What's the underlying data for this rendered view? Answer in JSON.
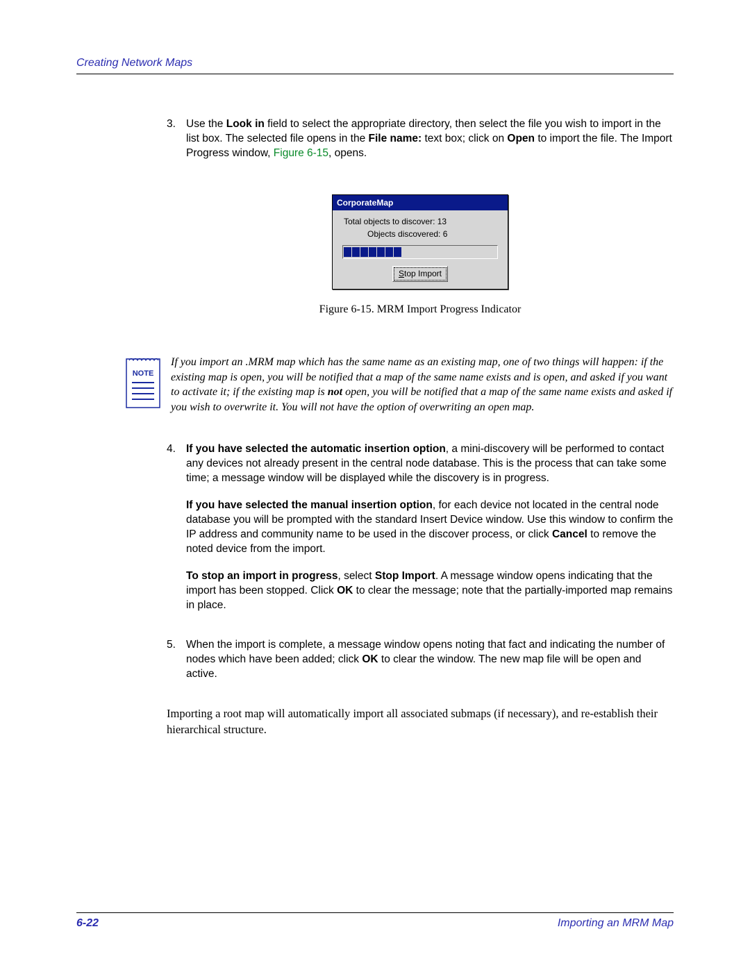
{
  "header": {
    "title": "Creating Network Maps"
  },
  "step3": {
    "num": "3.",
    "p1a": "Use the ",
    "look_in": "Look in",
    "p1b": " field to select the appropriate directory, then select the file you wish to import in the list box. The selected file opens in the ",
    "file_name": "File name:",
    "p1c": " text box; click on ",
    "open": "Open",
    "p1d": " to import the file. The Import Progress window, ",
    "figref": "Figure 6-15",
    "p1e": ", opens."
  },
  "dialog": {
    "title": "CorporateMap",
    "line1": "Total objects to discover:  13",
    "line2": "Objects discovered:  6",
    "stop_label_u": "S",
    "stop_label_rest": "top Import"
  },
  "figure_caption": "Figure 6-15.  MRM Import Progress Indicator",
  "note": {
    "label": "NOTE",
    "t1": "If you import an .MRM map which has the same name as an existing map, one of two things will happen: if the existing map is open, you will be notified that a map of the same name exists and is open, and asked if you want to activate it; if the existing map is ",
    "not": "not",
    "t2": " open, you will be notified that a map of the same name exists and asked if you wish to overwrite it. You will not have the option of overwriting an open map."
  },
  "step4": {
    "num": "4.",
    "p1a": "If you have selected the automatic insertion option",
    "p1b": ", a mini-discovery will be performed to contact any devices not already present in the central node database. This is the process that can take some time; a message window will be displayed while the discovery is in progress.",
    "p2a": "If you have selected the manual insertion option",
    "p2b": ", for each device not located in the central node database you will be prompted with the standard Insert Device window. Use this window to confirm the IP address and community name to be used in the discover process, or click ",
    "cancel": "Cancel",
    "p2c": " to remove the noted device from the import.",
    "p3a": "To stop an import in progress",
    "p3b": ", select ",
    "stop_import": "Stop Import",
    "p3c": ". A message window opens indicating that the import has been stopped. Click ",
    "ok1": "OK",
    "p3d": " to clear the message; note that the partially-imported map remains in place."
  },
  "step5": {
    "num": "5.",
    "t1": "When the import is complete, a message window opens noting that fact and indicating the number of nodes which have been added; click ",
    "ok": "OK",
    "t2": " to clear the window. The new map file will be open and active."
  },
  "closing": "Importing a root map will automatically import all associated submaps (if necessary), and re-establish their hierarchical structure.",
  "footer": {
    "pageno": "6-22",
    "section": "Importing an MRM Map"
  }
}
